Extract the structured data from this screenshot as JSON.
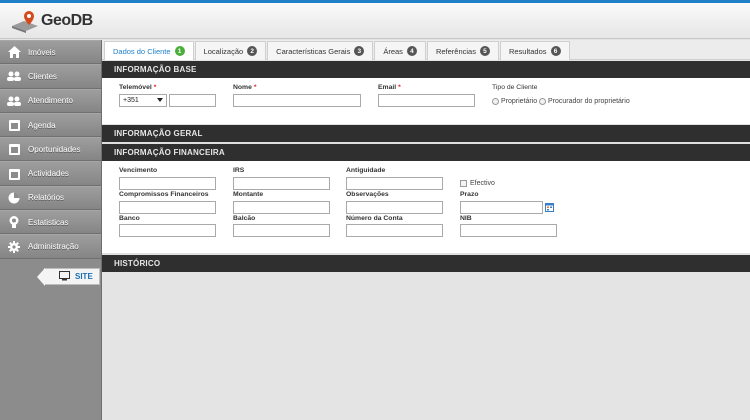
{
  "app": {
    "logo_text": "GeoDB",
    "accent": "#1f7fc7",
    "dark_bar": "#2f2f2f",
    "tab_active_badge": "#4cae3a"
  },
  "sidebar": {
    "items": [
      {
        "label": "Imóveis",
        "icon": "house-icon"
      },
      {
        "label": "Clientes",
        "icon": "users-icon"
      },
      {
        "label": "Atendimento",
        "icon": "users-icon"
      },
      {
        "label": "Agenda",
        "icon": "calendar-icon"
      },
      {
        "label": "Oportunidades",
        "icon": "calendar-icon"
      },
      {
        "label": "Actividades",
        "icon": "calendar-icon"
      },
      {
        "label": "Relatórios",
        "icon": "chart-icon"
      },
      {
        "label": "Estatisticas",
        "icon": "bulb-icon"
      },
      {
        "label": "Administração",
        "icon": "gear-icon"
      }
    ],
    "site_label": "SITE"
  },
  "tabs": [
    {
      "label": "Dados do Cliente",
      "num": "1"
    },
    {
      "label": "Localização",
      "num": "2"
    },
    {
      "label": "Características Gerais",
      "num": "3"
    },
    {
      "label": "Áreas",
      "num": "4"
    },
    {
      "label": "Referências",
      "num": "5"
    },
    {
      "label": "Resultados",
      "num": "6"
    }
  ],
  "sections": {
    "base": "INFORMAÇÃO BASE",
    "geral": "INFORMAÇÃO GERAL",
    "financeira": "INFORMAÇÃO FINANCEIRA",
    "historico": "HISTÓRICO"
  },
  "base": {
    "telemovel_label": "Telemóvel",
    "telemovel_code": "+351",
    "telemovel_value": "",
    "nome_label": "Nome",
    "nome_value": "",
    "email_label": "Email",
    "email_value": "",
    "required_mark": "*",
    "tipo_label": "Tipo de Cliente",
    "tipo_options": [
      "Proprietário",
      "Procurador do proprietário"
    ]
  },
  "financeira": {
    "vencimento": "Vencimento",
    "irs": "IRS",
    "antiguidade": "Antiguidade",
    "efectivo": "Efectivo",
    "compromissos": "Compromissos Financeiros",
    "montante": "Montante",
    "observacoes": "Observações",
    "prazo": "Prazo",
    "banco": "Banco",
    "balcao": "Balcão",
    "numero_conta": "Número da Conta",
    "nib": "NIB"
  }
}
